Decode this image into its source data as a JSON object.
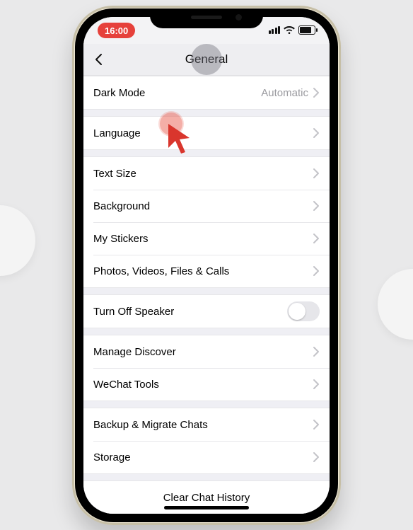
{
  "status": {
    "clock": "16:00"
  },
  "nav": {
    "title": "General"
  },
  "groups": [
    {
      "rows": [
        {
          "label": "Dark Mode",
          "value": "Automatic",
          "kind": "chevron"
        }
      ]
    },
    {
      "rows": [
        {
          "label": "Language",
          "kind": "chevron",
          "highlighted": true
        }
      ]
    },
    {
      "rows": [
        {
          "label": "Text Size",
          "kind": "chevron"
        },
        {
          "label": "Background",
          "kind": "chevron"
        },
        {
          "label": "My Stickers",
          "kind": "chevron"
        },
        {
          "label": "Photos, Videos, Files & Calls",
          "kind": "chevron"
        }
      ]
    },
    {
      "rows": [
        {
          "label": "Turn Off Speaker",
          "kind": "toggle",
          "on": false
        }
      ]
    },
    {
      "rows": [
        {
          "label": "Manage Discover",
          "kind": "chevron"
        },
        {
          "label": "WeChat Tools",
          "kind": "chevron"
        }
      ]
    },
    {
      "rows": [
        {
          "label": "Backup & Migrate Chats",
          "kind": "chevron"
        },
        {
          "label": "Storage",
          "kind": "chevron"
        }
      ]
    },
    {
      "rows": [
        {
          "label": "Clear Chat History",
          "kind": "center"
        }
      ]
    }
  ]
}
